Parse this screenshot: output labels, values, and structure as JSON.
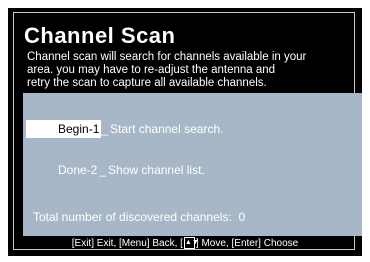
{
  "dialog": {
    "title": "Channel  Scan",
    "description_lines": [
      "Channel scan will search for channels available in your",
      "area. you may have to re-adjust the antenna and",
      "retry the scan to capture all available channels."
    ]
  },
  "menu": {
    "items": [
      {
        "key": "Begin-1",
        "separator": "_",
        "label": "Start channel search.",
        "selected": true
      },
      {
        "key": "Done-2",
        "separator": "_",
        "label": "Show channel list.",
        "selected": false
      }
    ],
    "total_label": "Total number of discovered channels",
    "total_separator": ":",
    "total_value": "0"
  },
  "footer": {
    "exit": "[Exit] Exit,",
    "menu": "[Menu] Back,",
    "move_prefix": "[",
    "move_icon": "arrow-updown-icon",
    "move_suffix": "] Move,",
    "enter": "[Enter] Choose"
  },
  "colors": {
    "background": "#000000",
    "panel": "#a8b7c7",
    "text": "#ffffff",
    "highlight": "#ffffff"
  }
}
